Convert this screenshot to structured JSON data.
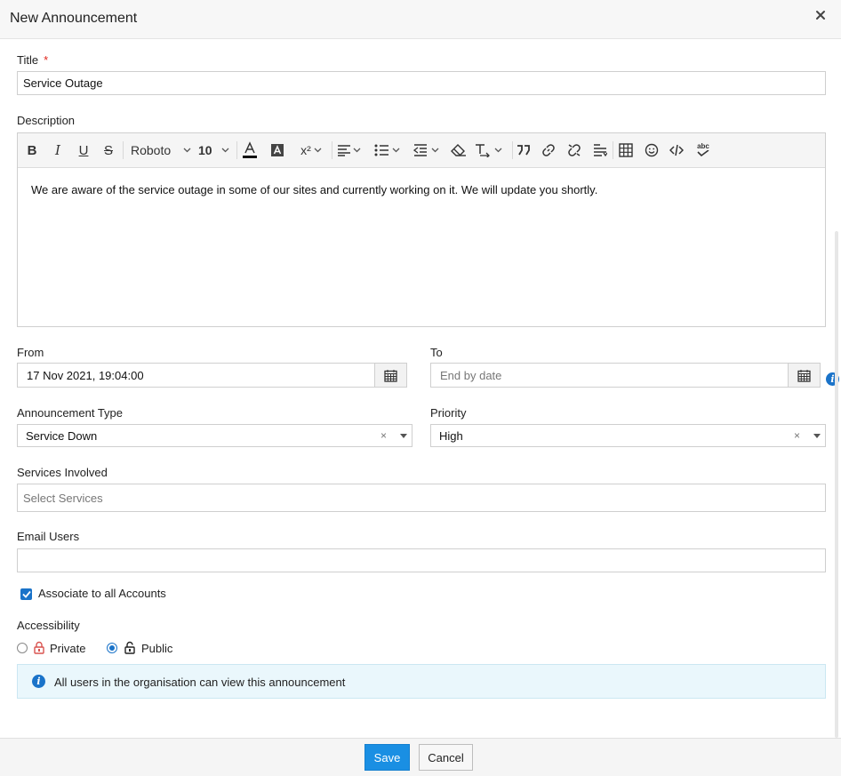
{
  "dialog": {
    "title": "New Announcement",
    "close_icon": "close-icon"
  },
  "form": {
    "title_label": "Title",
    "required_mark": "*",
    "title_value": "Service Outage",
    "description_label": "Description",
    "toolbar": {
      "font_family": "Roboto",
      "font_size": "10",
      "superscript": "x²",
      "icons": [
        "bold-icon",
        "italic-icon",
        "underline-icon",
        "strikethrough-icon",
        "font-color-icon",
        "background-color-icon",
        "superscript-icon",
        "align-icon",
        "list-icon",
        "indent-icon",
        "clear-format-icon",
        "text-direction-icon",
        "quote-icon",
        "link-icon",
        "unlink-icon",
        "line-height-icon",
        "table-icon",
        "emoji-icon",
        "code-icon",
        "spellcheck-icon"
      ]
    },
    "description_text": "We are aware of the service outage in some of our sites and currently working on it. We will update you shortly.",
    "from_label": "From",
    "from_value": "17 Nov 2021, 19:04:00",
    "to_label": "To",
    "to_placeholder": "End by date",
    "announcement_type_label": "Announcement Type",
    "announcement_type_value": "Service Down",
    "priority_label": "Priority",
    "priority_value": "High",
    "clear_mark": "×",
    "services_label": "Services Involved",
    "services_placeholder": "Select Services",
    "email_label": "Email Users",
    "email_value": "",
    "associate_label": "Associate to all Accounts",
    "associate_checked": true,
    "accessibility_label": "Accessibility",
    "private_label": "Private",
    "public_label": "Public",
    "selected_access": "Public",
    "info_text": "All users in the organisation can view this announcement"
  },
  "footer": {
    "save_label": "Save",
    "cancel_label": "Cancel"
  },
  "colors": {
    "accent": "#1a73c9",
    "save_button": "#1a8fe3",
    "required": "#e0251b",
    "info_bg": "#eaf7fc",
    "lock_private": "#d9534f"
  }
}
